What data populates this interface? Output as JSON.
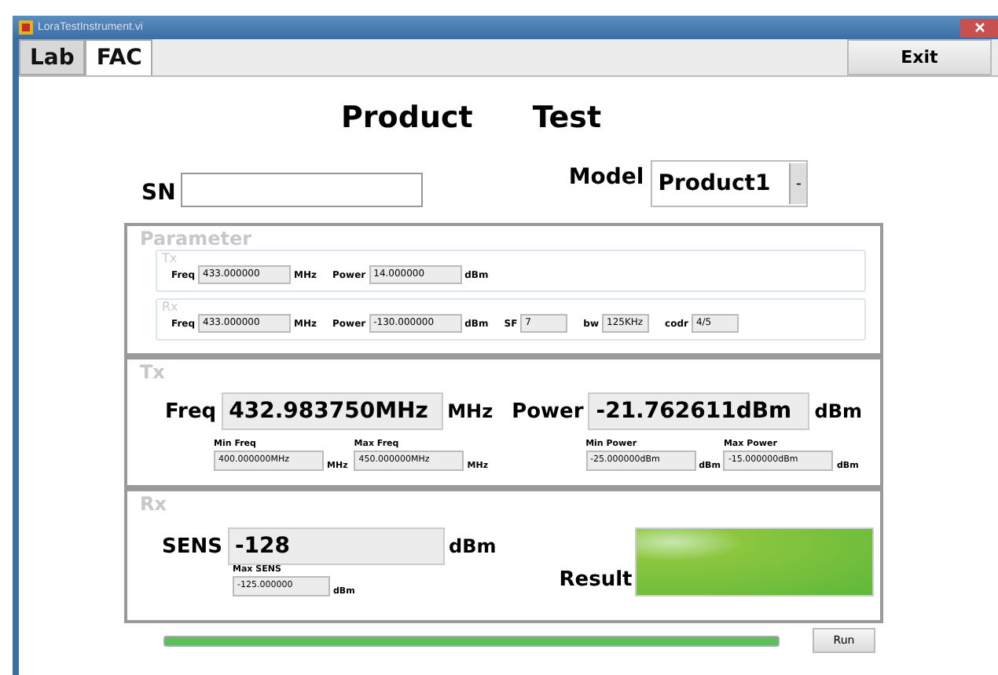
{
  "window": {
    "title": "LoraTestInstrument.vi"
  },
  "tabs": [
    {
      "label": "Lab",
      "selected": false
    },
    {
      "label": "FAC",
      "selected": true
    }
  ],
  "exit_button": "Exit",
  "heading": [
    "Product",
    "Test"
  ],
  "sn": {
    "label": "SN"
  },
  "model": {
    "label": "Model",
    "value": "Product1",
    "arrow": "-"
  },
  "parameter": {
    "title": "Parameter",
    "tx": {
      "title": "Tx",
      "fields": [
        {
          "label": "Freq",
          "value": "433.000000",
          "unit": "MHz"
        },
        {
          "label": "Power",
          "value": "14.000000",
          "unit": "dBm"
        }
      ]
    },
    "rx": {
      "title": "Rx",
      "fields": [
        {
          "label": "Freq",
          "value": "433.000000",
          "unit": "MHz"
        },
        {
          "label": "Power",
          "value": "-130.000000",
          "unit": "dBm"
        },
        {
          "label": "SF",
          "value": "7"
        },
        {
          "label": "bw",
          "value": "125KHz"
        },
        {
          "label": "codr",
          "value": "4/5"
        }
      ]
    }
  },
  "tx": {
    "title": "Tx",
    "readings": [
      {
        "label": "Freq",
        "value": "432.983750MHz",
        "unit": "MHz"
      },
      {
        "label": "Power",
        "value": "-21.762611dBm",
        "unit": "dBm"
      }
    ],
    "limits": [
      {
        "label": "Min Freq",
        "value": "400.000000MHz",
        "unit": "MHz"
      },
      {
        "label": "Max Freq",
        "value": "450.000000MHz",
        "unit": "MHz"
      },
      {
        "label": "Min Power",
        "value": "-25.000000dBm",
        "unit": "dBm"
      },
      {
        "label": "Max Power",
        "value": "-15.000000dBm",
        "unit": "dBm"
      }
    ]
  },
  "rx": {
    "title": "Rx",
    "sens": {
      "label": "SENS",
      "value": "-128",
      "unit": "dBm"
    },
    "max_sens": {
      "label": "Max SENS",
      "value": "-125.000000",
      "unit": "dBm"
    },
    "result": {
      "label": "Result",
      "on": true
    }
  },
  "progress": {
    "level": 1.0
  },
  "run_button": "Run"
}
